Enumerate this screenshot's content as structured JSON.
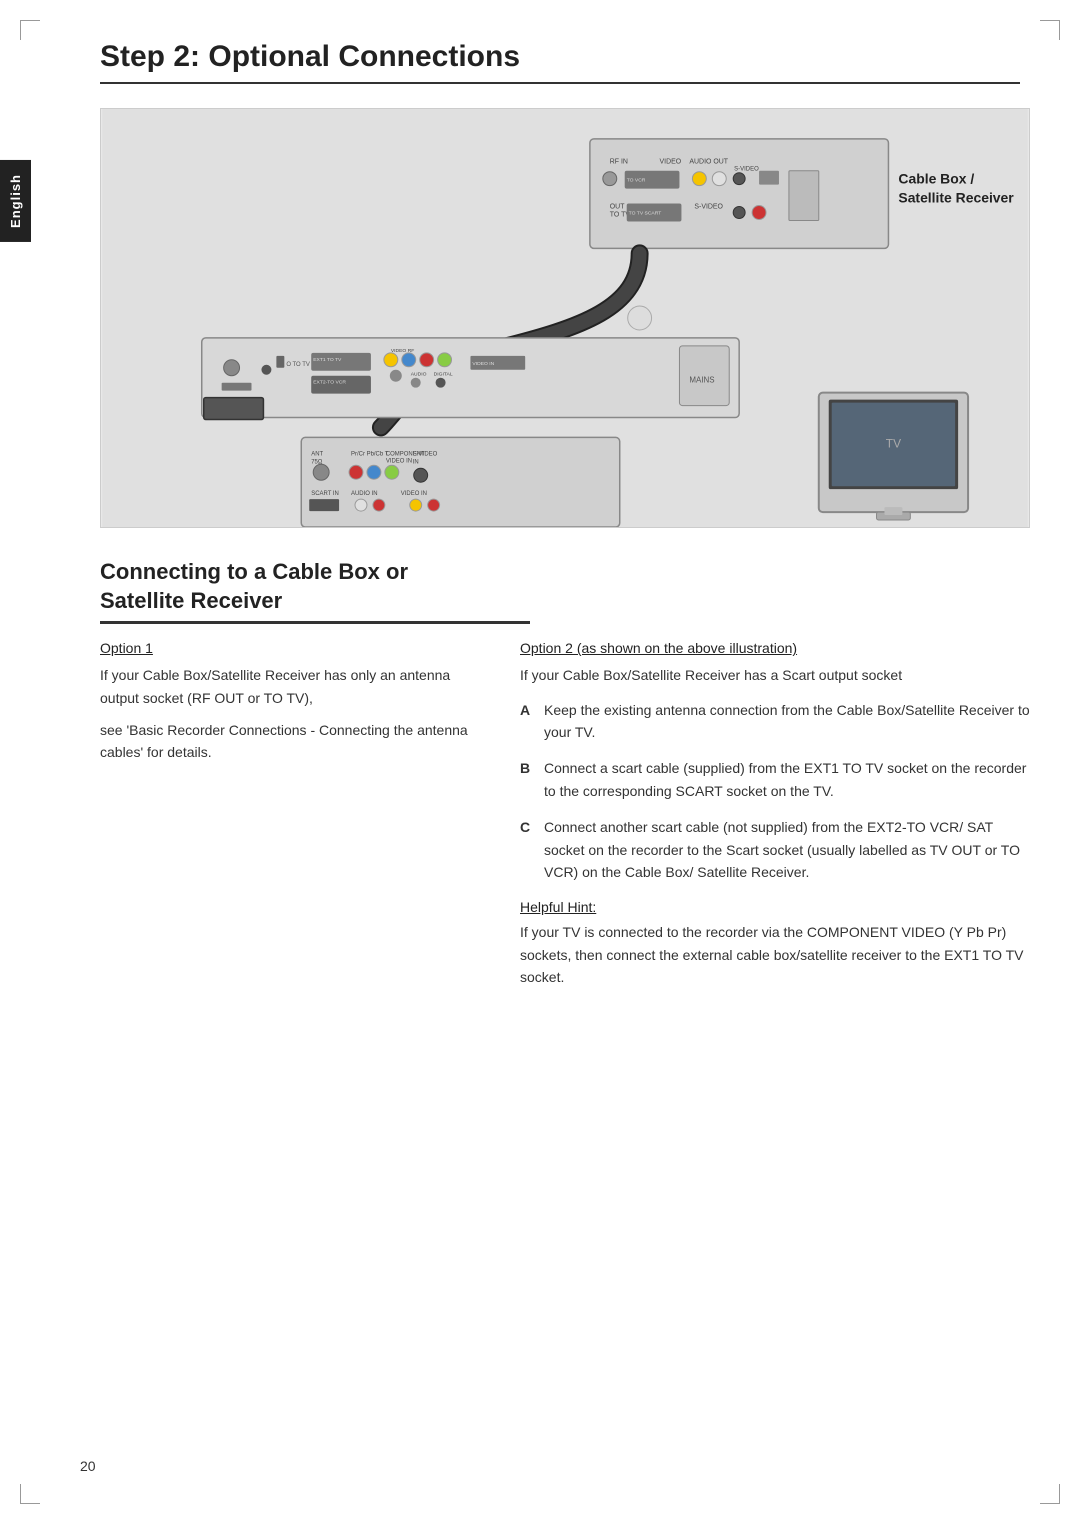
{
  "page": {
    "number": "20",
    "title": "Step 2: Optional Connections"
  },
  "english_tab": "English",
  "diagram": {
    "cable_box_label": "Cable Box /",
    "satellite_receiver_label": "Satellite Receiver"
  },
  "section": {
    "heading_line1": "Connecting to a Cable Box or",
    "heading_line2": "Satellite Receiver"
  },
  "col_left": {
    "option1_title": "Option 1",
    "option1_text1": "If your Cable Box/Satellite Receiver has only an antenna output socket (RF OUT or TO TV),",
    "option1_text2": "see 'Basic Recorder Connections - Connecting the antenna cables' for details."
  },
  "col_right": {
    "option2_title": "Option 2 (as shown on the above illustration)",
    "option2_intro": "If your Cable Box/Satellite Receiver has a Scart output socket",
    "items": [
      {
        "letter": "A",
        "text": "Keep the existing antenna connection from the Cable Box/Satellite Receiver to your TV."
      },
      {
        "letter": "B",
        "text": "Connect a scart cable (supplied) from the EXT1 TO TV  socket on the recorder to the corresponding SCART socket on the TV."
      },
      {
        "letter": "C",
        "text": "Connect another scart cable (not supplied) from the EXT2-TO VCR/ SAT  socket on the recorder to the Scart socket (usually labelled as TV OUT or TO VCR) on the Cable Box/ Satellite Receiver."
      }
    ],
    "helpful_hint_title": "Helpful Hint:",
    "helpful_hint_text": "If your TV is connected to the recorder via the COMPONENT VIDEO (Y Pb Pr) sockets, then connect the external cable box/satellite receiver to the EXT1 TO TV socket."
  }
}
